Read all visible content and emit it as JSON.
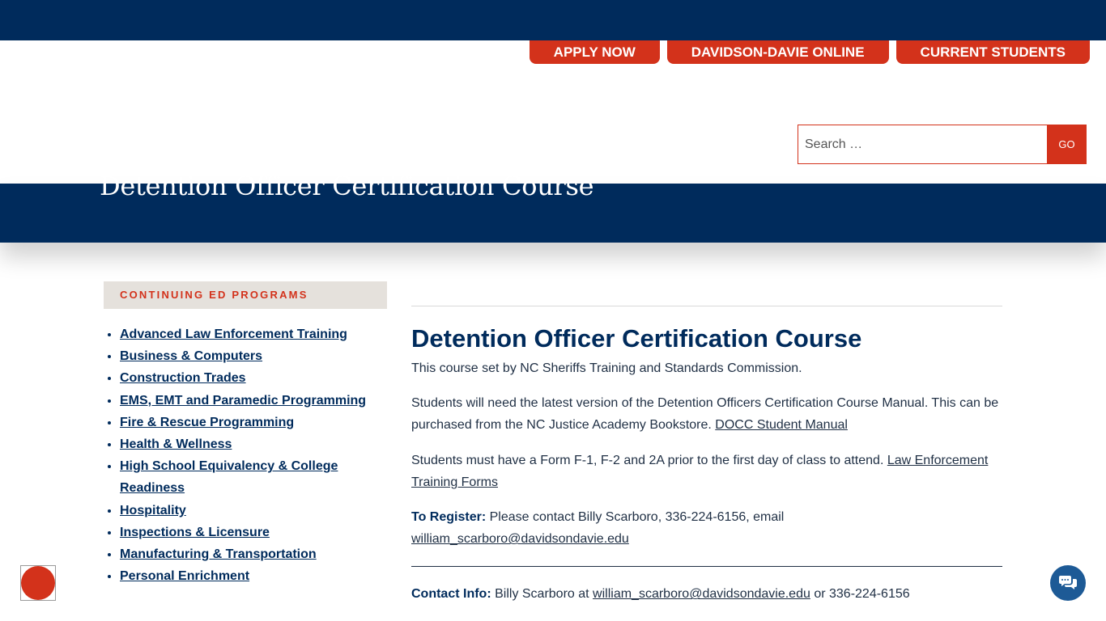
{
  "header": {
    "quick_links": [
      {
        "label": "APPLY NOW"
      },
      {
        "label": "DAVIDSON-DAVIE ONLINE"
      },
      {
        "label": "CURRENT STUDENTS"
      }
    ],
    "search": {
      "placeholder": "Search …",
      "go_label": "GO"
    }
  },
  "banner": {
    "title": "Detention Officer Certification Course"
  },
  "sidebar": {
    "heading": "CONTINUING ED PROGRAMS",
    "items": [
      {
        "label": "Advanced Law Enforcement Training"
      },
      {
        "label": "Business & Computers"
      },
      {
        "label": "Construction Trades"
      },
      {
        "label": "EMS, EMT and Paramedic Programming"
      },
      {
        "label": "Fire & Rescue Programming"
      },
      {
        "label": "Health & Wellness"
      },
      {
        "label": "High School Equivalency & College Readiness"
      },
      {
        "label": "Hospitality"
      },
      {
        "label": "Inspections & Licensure"
      },
      {
        "label": "Manufacturing & Transportation"
      },
      {
        "label": "Personal Enrichment"
      }
    ]
  },
  "content": {
    "title": "Detention Officer Certification Course",
    "intro": "This course set by NC Sheriffs Training and Standards Commission.",
    "manual_text": "Students will need the latest version of the Detention Officers Certification Course Manual.  This can be purchased from the NC Justice Academy Bookstore. ",
    "manual_link": "DOCC Student Manual",
    "forms_text": "Students must have a Form F-1, F-2 and 2A prior to the first day of class to attend. ",
    "forms_link": "Law Enforcement Training Forms",
    "register_label": "To Register:",
    "register_text": " Please contact Billy Scarboro, 336-224-6156, email ",
    "register_email": "william_scarboro@davidsondavie.edu",
    "contact_label": "Contact Info:",
    "contact_text": " Billy Scarboro at ",
    "contact_email": "william_scarboro@davidsondavie.edu",
    "contact_phone": " or 336-224-6156"
  },
  "colors": {
    "navy": "#002b5c",
    "accent_red": "#d3321b",
    "sidebar_heading_bg": "#e5e1dc",
    "chat_blue": "#1d5a96"
  },
  "icons": {
    "chat": "chat-bubbles-icon",
    "accessibility": "accessibility-icon"
  }
}
